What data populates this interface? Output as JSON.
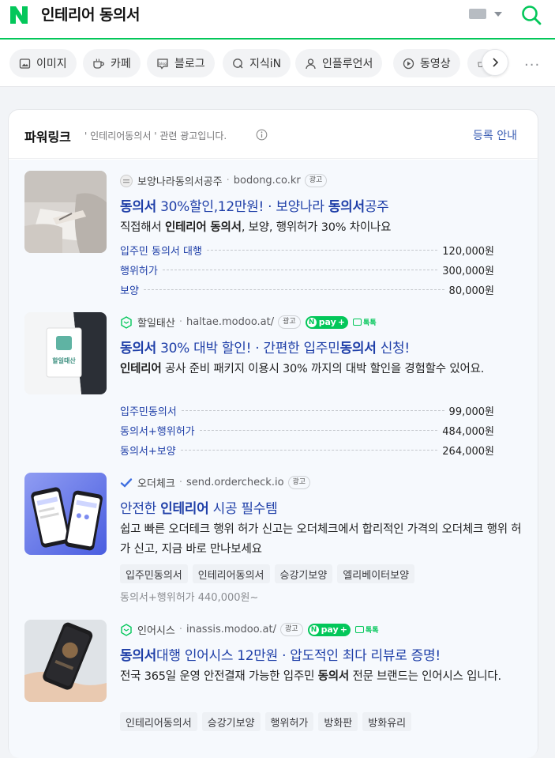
{
  "header": {
    "logo_letter": "N",
    "query": "인테리어 동의서"
  },
  "tabs": [
    {
      "label": "이미지",
      "icon": "image-icon"
    },
    {
      "label": "카페",
      "icon": "cafe-icon"
    },
    {
      "label": "블로그",
      "icon": "blog-icon"
    },
    {
      "label": "지식iN",
      "icon": "kin-icon"
    },
    {
      "label": "인플루언서",
      "icon": "person-icon"
    },
    {
      "label": "동영상",
      "icon": "play-icon"
    }
  ],
  "powerlink": {
    "title": "파워링크",
    "subtitle": "' 인테리어동의서 ' 관련 광고입니다.",
    "register": "등록 안내"
  },
  "ads": [
    {
      "site": "보양나라동의서공주",
      "url": "bodong.co.kr",
      "badge": "광고",
      "headline": [
        {
          "t": "동의서",
          "b": true
        },
        {
          "t": " 30%할인,12만원! · 보양나라 ",
          "b": false
        },
        {
          "t": "동의서",
          "b": true
        },
        {
          "t": "공주",
          "b": false
        }
      ],
      "desc": [
        {
          "t": "직접해서 ",
          "b": false
        },
        {
          "t": "인테리어 동의서",
          "b": true
        },
        {
          "t": ", 보양, 행위허가 30% 차이나요",
          "b": false
        }
      ],
      "prices": [
        {
          "name": "입주민 동의서 대행",
          "value": "120,000원"
        },
        {
          "name": "행위허가",
          "value": "300,000원"
        },
        {
          "name": "보양",
          "value": "80,000원"
        }
      ]
    },
    {
      "site": "할일태산",
      "url": "haltae.modoo.at/",
      "badge": "광고",
      "npay": "pay",
      "talk": "톡톡",
      "thumb_sign": "할일태산",
      "headline": [
        {
          "t": "동의서",
          "b": true
        },
        {
          "t": " 30% 대박 할인! · 간편한 입주민",
          "b": false
        },
        {
          "t": "동의서",
          "b": true
        },
        {
          "t": " 신청!",
          "b": false
        }
      ],
      "desc": [
        {
          "t": "인테리어",
          "b": true
        },
        {
          "t": " 공사 준비 패키지 이용시 30% 까지의 대박 할인을 경험할수 있어요.",
          "b": false
        }
      ],
      "prices": [
        {
          "name": "입주민동의서",
          "value": "99,000원"
        },
        {
          "name": "동의서+행위허가",
          "value": "484,000원"
        },
        {
          "name": "동의서+보양",
          "value": "264,000원"
        }
      ]
    },
    {
      "site": "오더체크",
      "url": "send.ordercheck.io",
      "badge": "광고",
      "headline": [
        {
          "t": "안전한 ",
          "b": false
        },
        {
          "t": "인테리어",
          "b": true
        },
        {
          "t": " 시공 필수템",
          "b": false
        }
      ],
      "desc": [
        {
          "t": "쉽고 빠른 오더테크 행위 허가 신고는 오더체크에서 합리적인 가격의 오더체크 행위 허가 신고, 지금 바로 만나보세요",
          "b": false
        }
      ],
      "tags": [
        "입주민동의서",
        "인테리어동의서",
        "승강기보양",
        "엘리베이터보양"
      ],
      "tag_note": "동의서+행위허가 440,000원~"
    },
    {
      "site": "인어시스",
      "url": "inassis.modoo.at/",
      "badge": "광고",
      "npay": "pay",
      "talk": "톡톡",
      "headline": [
        {
          "t": "동의서",
          "b": true
        },
        {
          "t": "대행 인어시스 12만원 · 압도적인 최다 리뷰로 증명!",
          "b": false
        }
      ],
      "desc": [
        {
          "t": "전국 365일 운영 안전결재 가능한 입주민 ",
          "b": false
        },
        {
          "t": "동의서",
          "b": true
        },
        {
          "t": " 전문 브랜드는 인어시스 입니다.",
          "b": false
        }
      ],
      "tags": [
        "인테리어동의서",
        "승강기보양",
        "행위허가",
        "방화판",
        "방화유리"
      ]
    }
  ],
  "colors": {
    "brand": "#03c75a",
    "link": "#1f3fa8"
  }
}
